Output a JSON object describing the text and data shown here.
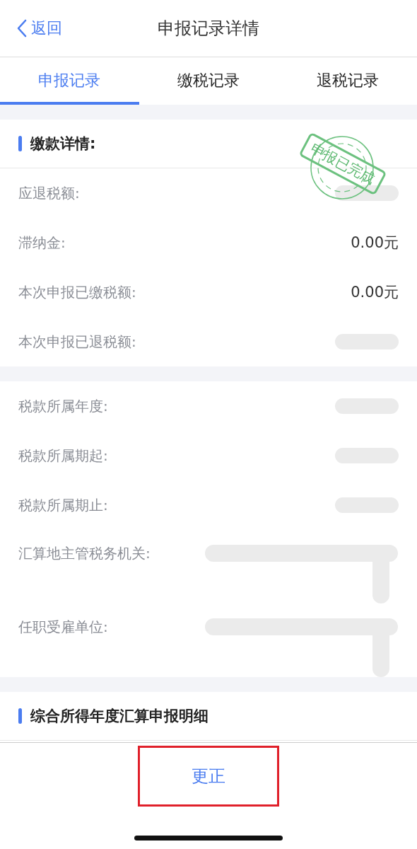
{
  "nav": {
    "back": "返回",
    "title": "申报记录详情"
  },
  "tabs": [
    {
      "label": "申报记录",
      "selected": true
    },
    {
      "label": "缴税记录",
      "selected": false
    },
    {
      "label": "退税记录",
      "selected": false
    }
  ],
  "payment": {
    "heading": "缴款详情:",
    "stamp": "申报已完成",
    "rows": [
      {
        "label": "应退税额:",
        "redacted": true
      },
      {
        "label": "滞纳金:",
        "value": "0.00元"
      },
      {
        "label": "本次申报已缴税额:",
        "value": "0.00元"
      },
      {
        "label": "本次申报已退税额:",
        "redacted": true
      }
    ]
  },
  "period": {
    "rows": [
      {
        "label": "税款所属年度:",
        "redacted": true
      },
      {
        "label": "税款所属期起:",
        "redacted": true
      },
      {
        "label": "税款所属期止:",
        "redacted": true
      },
      {
        "label": "汇算地主管税务机关:",
        "redacted": true,
        "tall": true
      },
      {
        "label": "任职受雇单位:",
        "redacted": true,
        "tall": true
      }
    ]
  },
  "detail": {
    "heading": "综合所得年度汇算申报明细"
  },
  "footer": {
    "button": "更正",
    "highlighted": true
  }
}
